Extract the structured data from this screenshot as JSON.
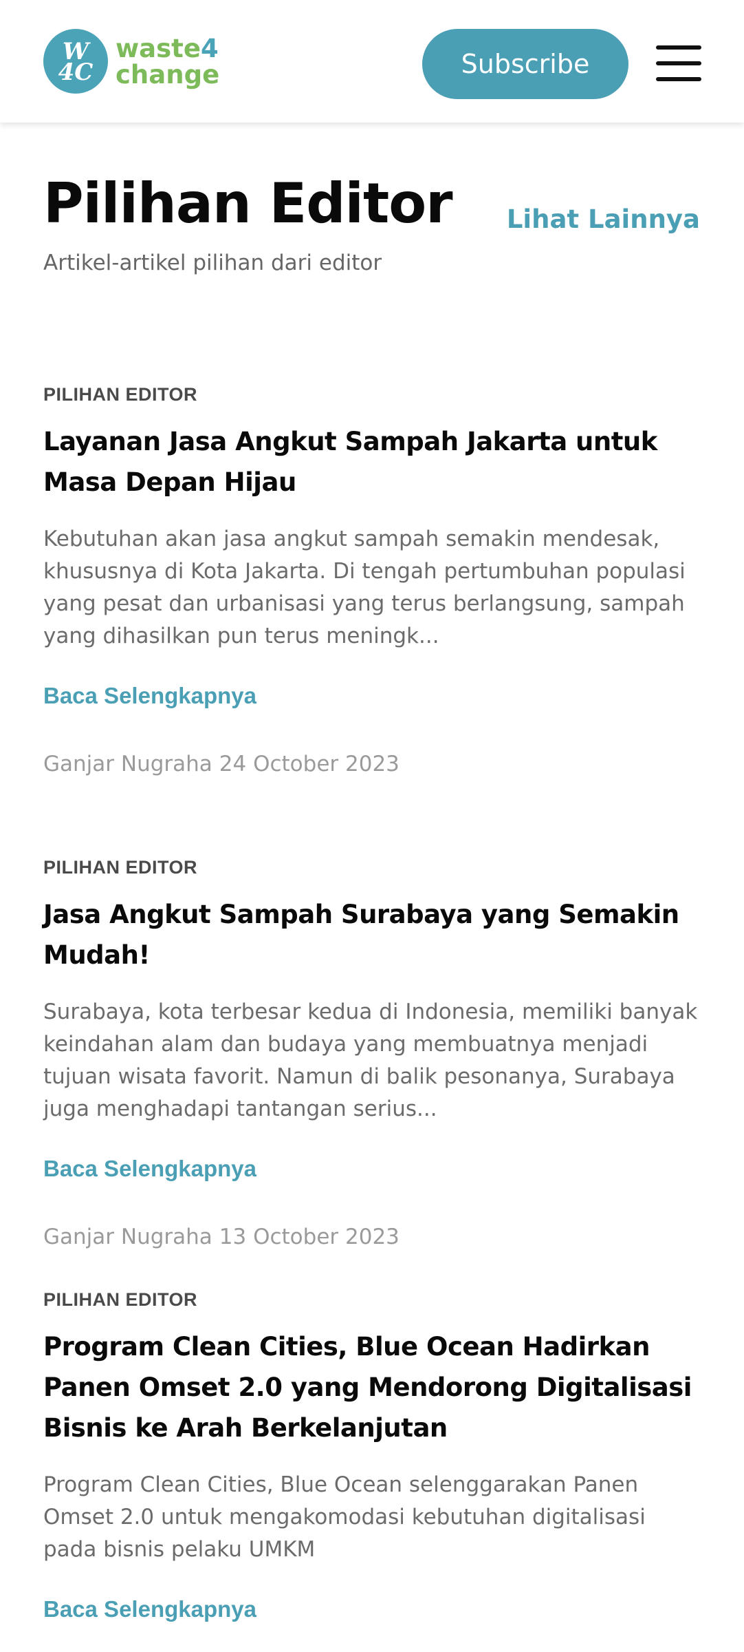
{
  "header": {
    "logo_mark_line1": "W",
    "logo_mark_line2": "4C",
    "logo_word_line1": "waste",
    "logo_word_four": "4",
    "logo_word_line2": "change",
    "subscribe_label": "Subscribe",
    "menu_icon": "hamburger-menu-icon"
  },
  "section": {
    "title": "Pilihan Editor",
    "subtitle": "Artikel-artikel pilihan dari editor",
    "see_more_label": "Lihat Lainnya"
  },
  "articles": [
    {
      "category": "PILIHAN EDITOR",
      "title": "Layanan Jasa Angkut Sampah Jakarta untuk Masa Depan Hijau",
      "excerpt": "Kebutuhan akan jasa angkut sampah semakin mendesak, khususnya di Kota Jakarta. Di tengah pertumbuhan populasi yang pesat dan urbanisasi yang terus berlangsung, sampah yang dihasilkan pun terus meningk...",
      "read_more": "Baca Selengkapnya",
      "author": "Ganjar Nugraha",
      "date": "24 October 2023"
    },
    {
      "category": "PILIHAN EDITOR",
      "title": "Jasa Angkut Sampah Surabaya yang Semakin Mudah!",
      "excerpt": "Surabaya, kota terbesar kedua di Indonesia, memiliki banyak keindahan alam dan budaya yang membuatnya menjadi tujuan wisata favorit. Namun di balik pesonanya, Surabaya juga menghadapi tantangan serius...",
      "read_more": "Baca Selengkapnya",
      "author": "Ganjar Nugraha",
      "date": "13 October 2023"
    },
    {
      "category": "PILIHAN EDITOR",
      "title": "Program Clean Cities, Blue Ocean Hadirkan Panen Omset 2.0 yang Mendorong Digitalisasi Bisnis ke Arah Berkelanjutan",
      "excerpt": "Program Clean Cities, Blue Ocean selenggarakan Panen Omset 2.0 untuk mengakomodasi kebutuhan digitalisasi pada bisnis pelaku UMKM",
      "read_more": "Baca Selengkapnya"
    }
  ],
  "colors": {
    "accent": "#4a9fb5",
    "logo_green": "#7dba5a",
    "title": "#0a0a0a",
    "muted": "#6b6b6b",
    "meta": "#9a9a9a"
  }
}
